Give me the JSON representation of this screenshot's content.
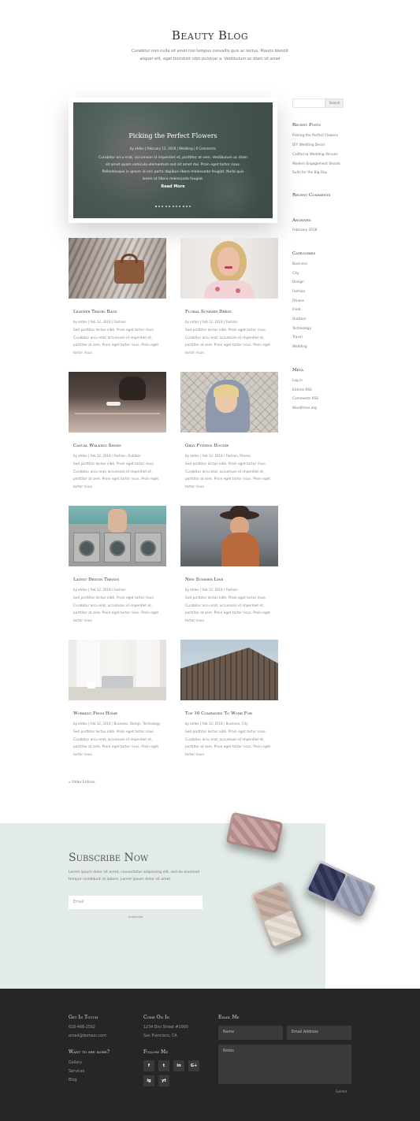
{
  "header": {
    "title": "Beauty Blog",
    "subtitle": "Curabitur non nulla sit amet nisl tempus convallis quis ac lectus. Mauris blandit aliquet elit, eget tincidunt nibh pulvinar a. Vestibulum ac diam sit amet"
  },
  "slider": {
    "title": "Picking the Perfect Flowers",
    "meta": "by etdev | February 12, 2018 | Wedding | 0 Comments",
    "excerpt": "Curabitur arcu erat, accumsan id imperdiet et, porttitor at sem. Vestibulum ac diam sit amet quam vehicula elementum sed sit amet dui. Proin eget tortor risus. Pellentesque in ipsum id orci porta dapibus libero malesuada feugiat. Nulla quis lorem ut libero malesuada feugiat.",
    "read_more": "Read More",
    "dot_count": 11,
    "active_dot": 0
  },
  "posts": [
    {
      "title": "Leather Travel Bags",
      "meta": "by etdev | Feb 12, 2018 | Fashion",
      "excerpt": "Sed porttitor lectus nibh. Proin eget tortor risus. Curabitur arcu erat, accumsan id imperdiet et, porttitor at sem. Proin eget tortor risus. Proin eget tortor risus."
    },
    {
      "title": "Floral Summer Dress",
      "meta": "by etdev | Feb 12, 2018 | Fashion",
      "excerpt": "Sed porttitor lectus nibh. Proin eget tortor risus. Curabitur arcu erat, accumsan id imperdiet et, porttitor at sem. Proin eget tortor risus. Proin eget tortor risus."
    },
    {
      "title": "Casual Walking Shoes",
      "meta": "by etdev | Feb 12, 2018 | Fashion, Outdoor",
      "excerpt": "Sed porttitor lectus nibh. Proin eget tortor risus. Curabitur arcu erat, accumsan id imperdiet et, porttitor at sem. Proin eget tortor risus. Proin eget tortor risus."
    },
    {
      "title": "Gray Fitness Hoodie",
      "meta": "by etdev | Feb 12, 2018 | Fashion, Fitness",
      "excerpt": "Sed porttitor lectus nibh. Proin eget tortor risus. Curabitur arcu erat, accumsan id imperdiet et, porttitor at sem. Proin eget tortor risus. Proin eget tortor risus."
    },
    {
      "title": "Latest Design Trends",
      "meta": "by etdev | Feb 12, 2018 | Fashion",
      "excerpt": "Sed porttitor lectus nibh. Proin eget tortor risus. Curabitur arcu erat, accumsan id imperdiet et, porttitor at sem. Proin eget tortor risus. Proin eget tortor risus."
    },
    {
      "title": "New Summer Line",
      "meta": "by etdev | Feb 12, 2018 | Fashion",
      "excerpt": "Sed porttitor lectus nibh. Proin eget tortor risus. Curabitur arcu erat, accumsan id imperdiet et, porttitor at sem. Proin eget tortor risus. Proin eget tortor risus."
    },
    {
      "title": "Working From Home",
      "meta": "by etdev | Feb 12, 2018 | Business, Design, Technology",
      "excerpt": "Sed porttitor lectus nibh. Proin eget tortor risus. Curabitur arcu erat, accumsan id imperdiet et, porttitor at sem. Proin eget tortor risus. Proin eget tortor risus."
    },
    {
      "title": "Top 10 Companies To Work For",
      "meta": "by etdev | Feb 12, 2018 | Business, City",
      "excerpt": "Sed porttitor lectus nibh. Proin eget tortor risus. Curabitur arcu erat, accumsan id imperdiet et, porttitor at sem. Proin eget tortor risus. Proin eget tortor risus."
    }
  ],
  "pagination": {
    "older": "« Older Entries"
  },
  "sidebar": {
    "search_button": "Search",
    "recent_posts_heading": "Recent Posts",
    "recent_posts": [
      "Picking the Perfect Flowers",
      "DIY Wedding Decor",
      "California Wedding Venues",
      "Modern Engagement Shoots",
      "Suits for the Big Day"
    ],
    "recent_comments_heading": "Recent Comments",
    "archives_heading": "Archives",
    "archives": [
      "February 2018"
    ],
    "categories_heading": "Categories",
    "categories": [
      "Business",
      "City",
      "Design",
      "Fashion",
      "Fitness",
      "Food",
      "Outdoor",
      "Technology",
      "Travel",
      "Wedding"
    ],
    "meta_heading": "Meta",
    "meta_links": [
      "Log in",
      "Entries RSS",
      "Comments RSS",
      "WordPress.org"
    ]
  },
  "subscribe": {
    "heading": "Subscribe Now",
    "text": "Lorem ipsum dolor sit amet, consectetur adipiscing elit, sed do eiusmod tempor incididunt ut labore. Lorem ipsum dolor sit amet.",
    "email_placeholder": "Email",
    "button": "Subscribe"
  },
  "footer": {
    "get_in_touch": "Get In Touch",
    "phone": "618-466-2592",
    "email": "email@domain.com",
    "come_on_in": "Come On In",
    "address1": "1234 Divi Street #1000",
    "address2": "San Francisco, CA",
    "want_more": "Want to see more?",
    "links": [
      "Gallery",
      "Services",
      "Blog"
    ],
    "follow_me": "Follow Me",
    "social": [
      "f",
      "t",
      "in",
      "G+",
      "ig",
      "yt"
    ],
    "email_me": "Email Me",
    "name_placeholder": "Name",
    "email_placeholder": "Email Address",
    "notes_placeholder": "Notes",
    "submit": "Submit"
  }
}
